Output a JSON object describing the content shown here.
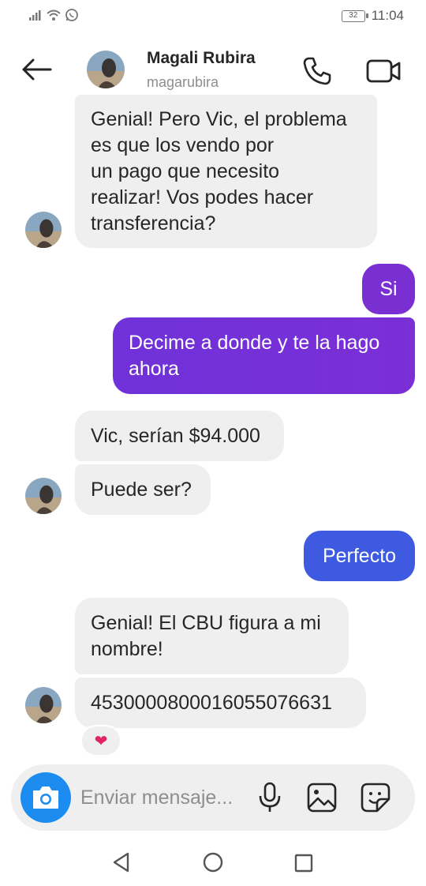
{
  "status_bar": {
    "battery": "32",
    "time": "11:04",
    "icons": [
      "signal-icon",
      "wifi-icon",
      "whatsapp-icon"
    ]
  },
  "header": {
    "name": "Magali Rubira",
    "username": "magarubira",
    "icons": [
      "back-arrow-icon",
      "phone-icon",
      "video-camera-icon"
    ]
  },
  "messages": [
    {
      "direction": "in",
      "lines": [
        "Genial! Pero Vic, el problema",
        "es que los vendo por",
        "un pago que necesito",
        "realizar! Vos podes hacer",
        "transferencia?"
      ]
    },
    {
      "direction": "out",
      "lines": [
        "Si"
      ]
    },
    {
      "direction": "out",
      "lines": [
        "Decime a donde y te la hago",
        "ahora"
      ]
    },
    {
      "direction": "in",
      "lines": [
        "Vic, serían $94.000"
      ]
    },
    {
      "direction": "in",
      "lines": [
        "Puede ser?"
      ]
    },
    {
      "direction": "out",
      "lines": [
        "Perfecto"
      ]
    },
    {
      "direction": "in",
      "lines": [
        "Genial! El CBU figura a mi",
        "nombre!"
      ]
    },
    {
      "direction": "in",
      "lines": [
        "4530000800016055076631"
      ]
    }
  ],
  "reaction": {
    "icon": "heart-icon",
    "glyph": "❤"
  },
  "composer": {
    "placeholder": "Enviar mensaje...",
    "icons": [
      "camera-icon",
      "microphone-icon",
      "gallery-icon",
      "sticker-icon"
    ]
  },
  "colors": {
    "outgoing_purple": "#7b2fd6",
    "outgoing_blue": "#3d5ae0",
    "incoming": "#efefef",
    "camera": "#1d8cf0"
  }
}
